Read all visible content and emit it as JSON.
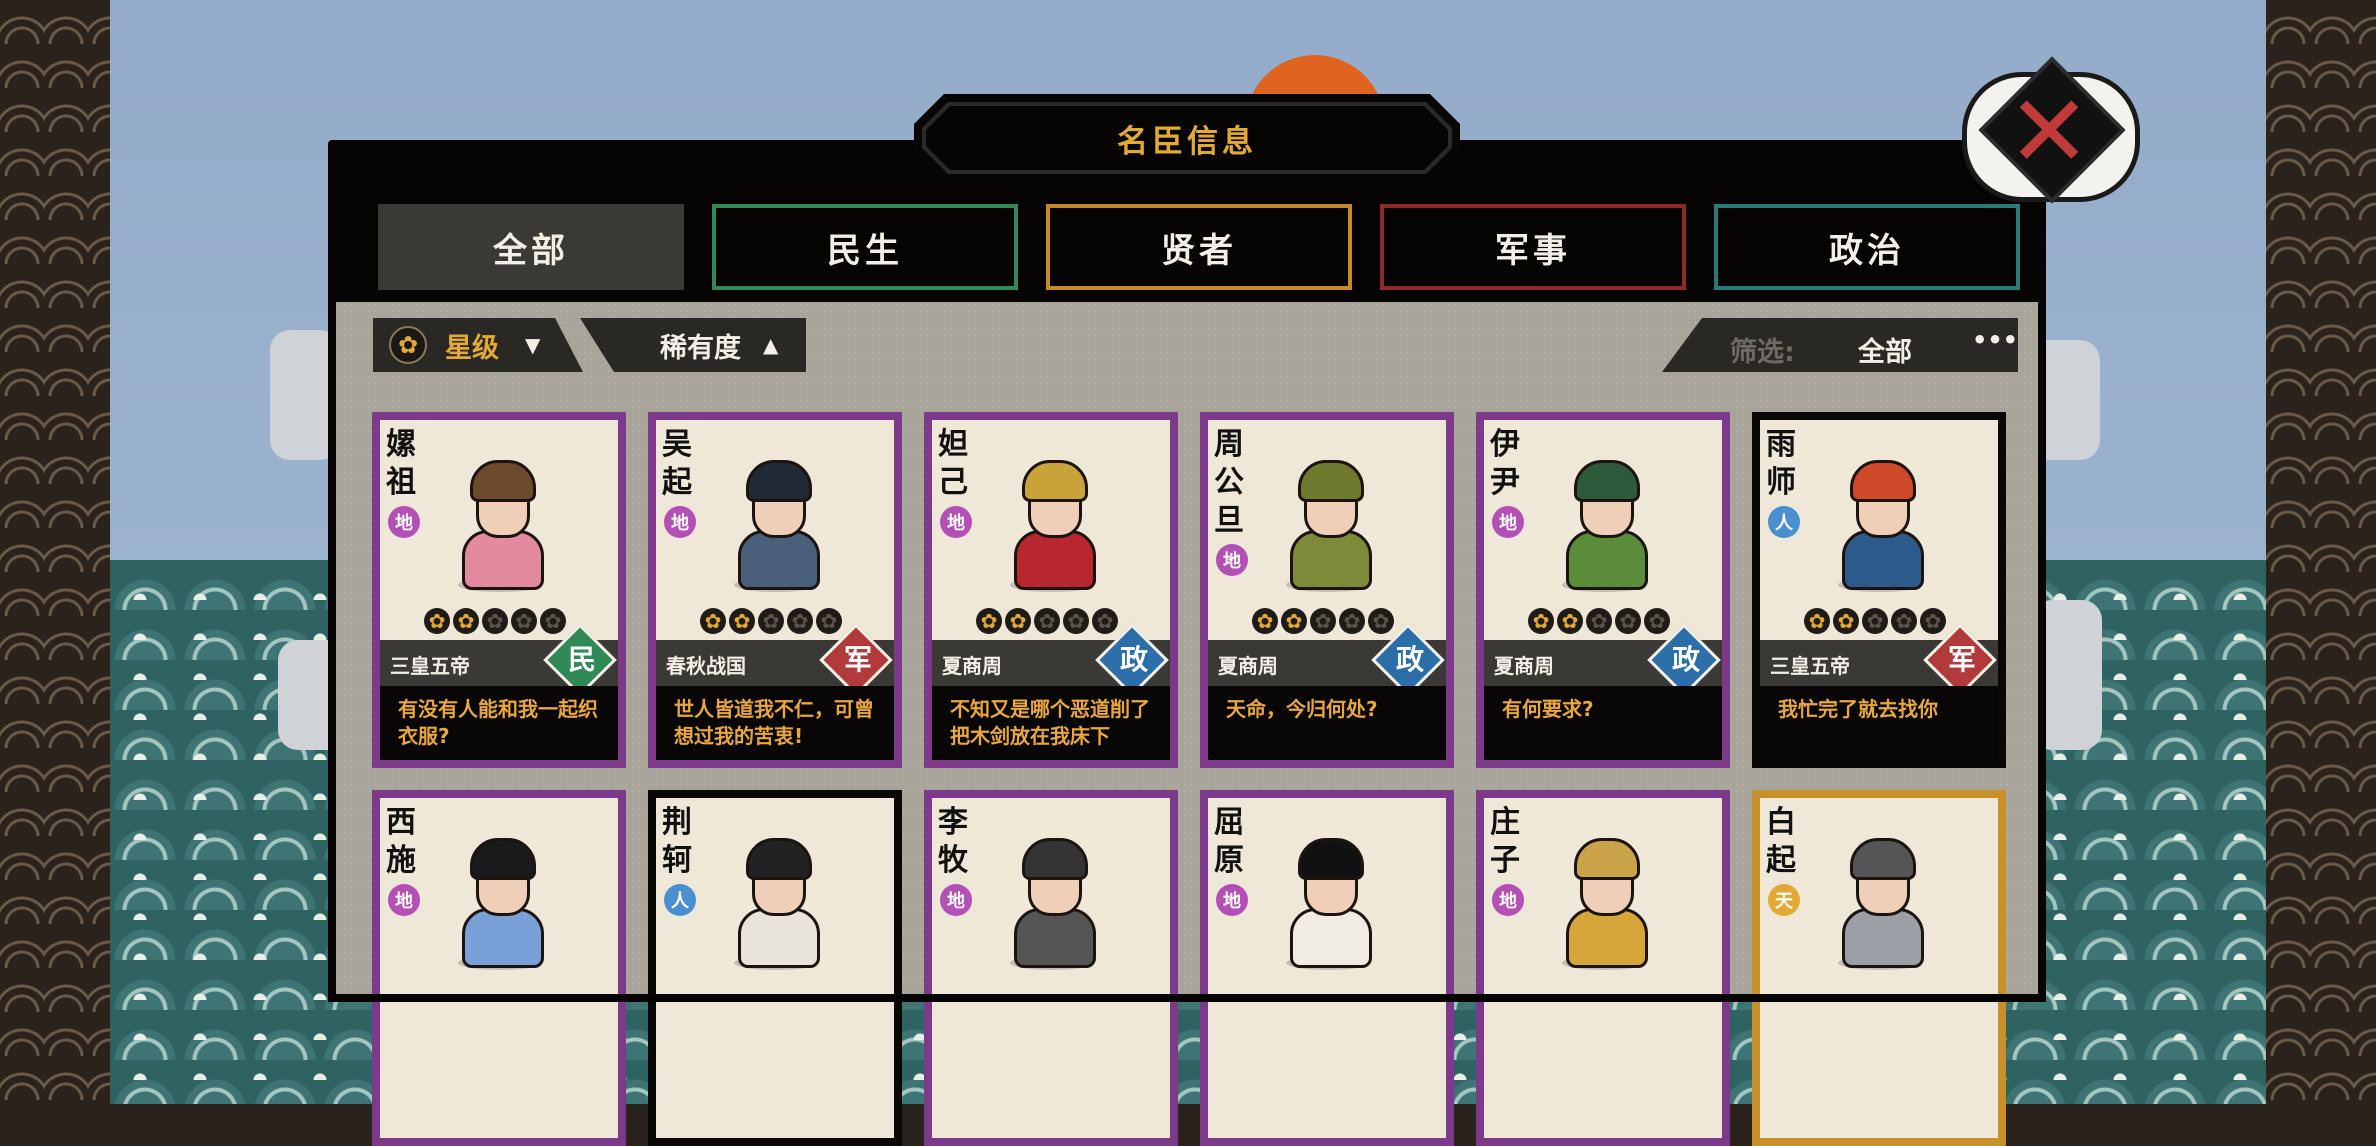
{
  "window": {
    "title": "名臣信息"
  },
  "tabs": [
    {
      "label": "全部",
      "color": "#3b3935"
    },
    {
      "label": "民生",
      "color": "#2f8a55"
    },
    {
      "label": "贤者",
      "color": "#c8892a"
    },
    {
      "label": "军事",
      "color": "#8f2a2a"
    },
    {
      "label": "政治",
      "color": "#2a7a78"
    }
  ],
  "sort": {
    "star_label": "星级",
    "rarity_label": "稀有度"
  },
  "filter": {
    "label": "筛选:",
    "value": "全部",
    "more": "•••"
  },
  "colors": {
    "rarity_di": "#b34fb5",
    "rarity_ren": "#4a8fd0",
    "rarity_tian": "#e2a935",
    "frame_purple": "#7e3a8a",
    "frame_gold": "#c8902a",
    "frame_black": "#0a0806",
    "type_min": "#2f8a55",
    "type_jun": "#b33a3a",
    "type_zheng": "#2c6fa8"
  },
  "cards": [
    {
      "name": [
        "嫘",
        "祖"
      ],
      "rarity": "地",
      "stars": 2,
      "era": "三皇五帝",
      "type": "民",
      "quote": "有没有人能和我一起织衣服?"
    },
    {
      "name": [
        "吴",
        "起"
      ],
      "rarity": "地",
      "stars": 2,
      "era": "春秋战国",
      "type": "军",
      "quote": "世人皆道我不仁，可曾想过我的苦衷!"
    },
    {
      "name": [
        "妲",
        "己"
      ],
      "rarity": "地",
      "stars": 2,
      "era": "夏商周",
      "type": "政",
      "quote": "不知又是哪个恶道削了把木剑放在我床下"
    },
    {
      "name": [
        "周",
        "公",
        "旦"
      ],
      "rarity": "地",
      "stars": 2,
      "era": "夏商周",
      "type": "政",
      "quote": "天命，今归何处?"
    },
    {
      "name": [
        "伊",
        "尹"
      ],
      "rarity": "地",
      "stars": 2,
      "era": "夏商周",
      "type": "政",
      "quote": "有何要求?"
    },
    {
      "name": [
        "雨",
        "师"
      ],
      "rarity": "人",
      "stars": 2,
      "era": "三皇五帝",
      "type": "军",
      "quote": "我忙完了就去找你"
    },
    {
      "name": [
        "西",
        "施"
      ],
      "rarity": "地"
    },
    {
      "name": [
        "荆",
        "轲"
      ],
      "rarity": "人"
    },
    {
      "name": [
        "李",
        "牧"
      ],
      "rarity": "地"
    },
    {
      "name": [
        "屈",
        "原"
      ],
      "rarity": "地"
    },
    {
      "name": [
        "庄",
        "子"
      ],
      "rarity": "地"
    },
    {
      "name": [
        "白",
        "起"
      ],
      "rarity": "天"
    }
  ]
}
